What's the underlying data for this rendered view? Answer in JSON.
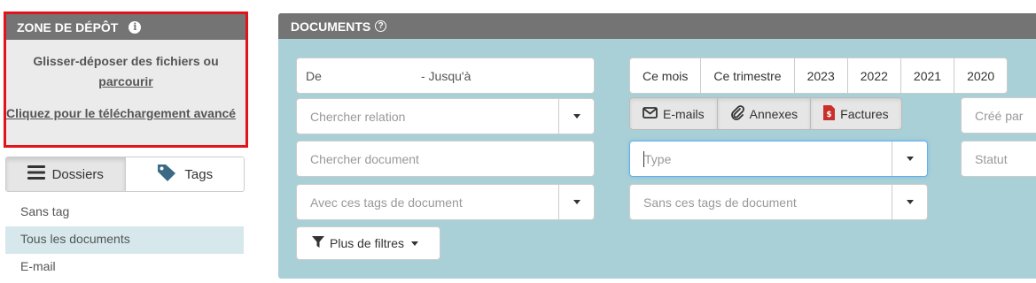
{
  "dropzone": {
    "title": "ZONE DE DÉPÔT",
    "info_icon": "info-circle-icon",
    "drag_text": "Glisser-déposer des fichiers ou",
    "browse_link": "parcourir",
    "advanced_link": "Cliquez pour le téléchargement avancé"
  },
  "toggle": {
    "folders_label": "Dossiers",
    "tags_label": "Tags",
    "folders_icon": "bars-icon",
    "tags_icon": "tag-icon"
  },
  "folders": [
    {
      "label": "Sans tag"
    },
    {
      "label": "Tous les documents",
      "selected": true
    },
    {
      "label": "E-mail"
    }
  ],
  "documents": {
    "title": "DOCUMENTS",
    "help_icon": "question-circle-icon",
    "date_from": "De",
    "date_to": "-  Jusqu'à",
    "periods": [
      "Ce mois",
      "Ce trimestre",
      "2023",
      "2022",
      "2021",
      "2020"
    ],
    "doc_types": [
      {
        "label": "E-mails",
        "icon": "envelope-icon"
      },
      {
        "label": "Annexes",
        "icon": "paperclip-icon"
      },
      {
        "label": "Factures",
        "icon": "invoice-file-icon",
        "color": "#c9302c"
      }
    ],
    "relation_placeholder": "Chercher relation",
    "document_placeholder": "Chercher document",
    "with_tags_placeholder": "Avec ces tags de document",
    "type_placeholder": "Type",
    "without_tags_placeholder": "Sans ces tags de document",
    "created_by_placeholder": "Créé par",
    "status_placeholder": "Statut",
    "more_filters": "Plus de filtres",
    "filter_icon": "filter-icon"
  },
  "colors": {
    "header_gray": "#747474",
    "panel_teal": "#a9d0d6",
    "highlight_red": "#e1131b",
    "selected_row": "#d6e8ec"
  }
}
